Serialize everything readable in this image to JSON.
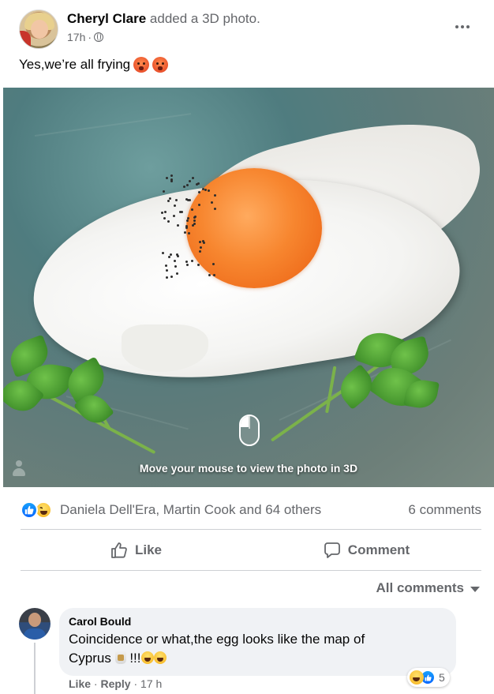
{
  "post": {
    "author": "Cheryl Clare",
    "action": "added a 3D photo.",
    "time": "17h",
    "separator": "·",
    "audience_icon": "globe-icon",
    "text": "Yes,we’re all frying",
    "text_emojis": [
      "hot-face",
      "hot-face"
    ]
  },
  "photo": {
    "caption": "Move your mouse to view the photo in 3D",
    "overlay_icon": "mouse-icon"
  },
  "reactions": {
    "types": [
      "like",
      "haha"
    ],
    "summary": "Daniela Dell'Era, Martin Cook and 64 others",
    "comments_count": "6 comments"
  },
  "actions": {
    "like_label": "Like",
    "comment_label": "Comment"
  },
  "comments_filter": {
    "label": "All comments"
  },
  "comment": {
    "author": "Carol Bould",
    "text_line1": "Coincidence or what,the egg looks like the map of",
    "text_line2": "Cyprus",
    "text_suffix": "!!!",
    "reaction_count": "5",
    "reaction_types": [
      "haha",
      "like"
    ],
    "like_label": "Like",
    "reply_label": "Reply",
    "separator": "·",
    "time": "17 h"
  },
  "colors": {
    "text_primary": "#050505",
    "text_secondary": "#65676b",
    "like_blue": "#0866ff",
    "bubble_bg": "#f0f2f5",
    "divider": "#ced0d4"
  }
}
